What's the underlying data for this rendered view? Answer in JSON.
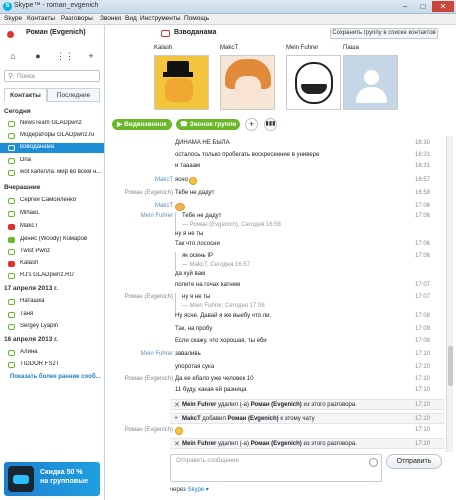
{
  "window": {
    "title": "Skype™ - roman_evgenich",
    "minimize": "–",
    "maximize": "□",
    "close": "✕"
  },
  "menu": [
    "Skype",
    "Контакты",
    "Разговоры",
    "Звонки",
    "Вид",
    "Инструменты",
    "Помощь"
  ],
  "profile": {
    "name": "Роман (Evgenich)"
  },
  "search": {
    "placeholder": "Поиск"
  },
  "tabs": {
    "contacts": "Контакты",
    "recent": "Последние"
  },
  "groups": {
    "today": "Сегодня",
    "yesterday": "Вчерашние",
    "apr17": "17 апреля 2013 г.",
    "apr16": "16 апреля 2013 г."
  },
  "contacts": {
    "today": [
      "NewsTeam GLADpwnz",
      "Модераторы GLADpwnz.ru",
      "Взводанама",
      "Dna",
      "wot капелла. мир во всем н..."
    ],
    "yesterday": [
      "Сергей Самойленко",
      "MihaeL",
      "MakcT",
      "Денис (Woody) Комаров",
      "Twist Pwnz",
      "Kalash",
      "RJ's GLADpwnz.RU"
    ],
    "apr17": [
      "Наташка",
      "Таня",
      "Sergey Lyapin"
    ],
    "apr16": [
      "Алина",
      "TIDDOR FS2T"
    ]
  },
  "more_link": "Показать более ранние сооб...",
  "ad": {
    "line1": "Скидка 50 %",
    "line2": "на групповые"
  },
  "conversation": {
    "title": "Взводанама",
    "save_button": "Сохранить группу в списке контактов",
    "participants": [
      "Kalash",
      "MakcT",
      "Mein Fuhrer",
      "Паша"
    ]
  },
  "calls": {
    "video": "Видеозвонок",
    "group": "Звонок группе",
    "add": "+"
  },
  "messages": [
    {
      "sender": "",
      "text": "ДИНАМА НЕ БЫЛА",
      "time": "16:30"
    },
    {
      "sender": "",
      "text": "осталось только пробегать воскресенние в универе",
      "time": "16:31"
    },
    {
      "sender": "",
      "text": "и таааам",
      "time": "16:31"
    },
    {
      "sender": "MakcT",
      "text": "ясно",
      "time": "16:57"
    },
    {
      "sender": "Роман (Evgenich)",
      "text": "Тебе не дадут",
      "time": "16:58"
    },
    {
      "sender": "MakcT",
      "text": "",
      "time": "17:06"
    },
    {
      "sender": "Mein Fuhrer",
      "text": "Тебе не дадут",
      "time": "17:06"
    },
    {
      "sender": "",
      "text": "— Роман (Evgenich), Сегодня 16:58",
      "time": ""
    },
    {
      "sender": "",
      "text": "ну я не ты",
      "time": ""
    },
    {
      "sender": "",
      "text": "Так что лососни",
      "time": "17:06"
    },
    {
      "sender": "",
      "text": "як осень IP",
      "time": "17:06"
    },
    {
      "sender": "",
      "text": "— MakcT, Сегодня 16:57",
      "time": ""
    },
    {
      "sender": "",
      "text": "да хуй вам",
      "time": ""
    },
    {
      "sender": "",
      "text": "полите на гочах катнем",
      "time": "17:07"
    },
    {
      "sender": "Роман (Evgenich)",
      "text": "ну я не ты",
      "time": "17:07"
    },
    {
      "sender": "",
      "text": "— Mein Fuhrer, Сегодня 17:06",
      "time": ""
    },
    {
      "sender": "",
      "text": "Ну ясне. Давай я же выебу что ли.",
      "time": "17:08"
    },
    {
      "sender": "",
      "text": "Так, на пробу",
      "time": "17:09"
    },
    {
      "sender": "",
      "text": "Если скажу, что хорошая, ты еби",
      "time": "17:09"
    },
    {
      "sender": "Mein Fuhrer",
      "text": "заваливь",
      "time": "17:10"
    },
    {
      "sender": "",
      "text": "упоротая сука",
      "time": "17:10"
    },
    {
      "sender": "Роман (Evgenich)",
      "text": "Да ее ебало уже человек 10",
      "time": "17:10"
    },
    {
      "sender": "",
      "text": "11 буду, какая ей разница",
      "time": "17:10"
    }
  ],
  "system_messages": [
    {
      "actor": "Mein Fuhrer",
      "action": "удалил (-а)",
      "target": "Роман (Evgenich)",
      "rest": "из этого разговора.",
      "time": "17:10"
    },
    {
      "actor": "MakcT",
      "action": "добавил",
      "target": "Роман (Evgenich)",
      "rest": "к этому чату",
      "time": "17:10"
    },
    {
      "actor": "Mein Fuhrer",
      "action": "удалил (-а)",
      "target": "Роман (Evgenich)",
      "rest": "из этого разговора.",
      "time": "17:10"
    }
  ],
  "emoji_sender": {
    "sender": "Роман (Evgenich)",
    "time": "17:10"
  },
  "composer": {
    "placeholder": "Отправить сообщение",
    "send": "Отправить",
    "via_prefix": "через",
    "via": "Skype ▾"
  },
  "colors": {
    "accent": "#00aff0",
    "call_green": "#6ab82a",
    "selection": "#1e8ed6",
    "sender": "#5a8fbf"
  }
}
